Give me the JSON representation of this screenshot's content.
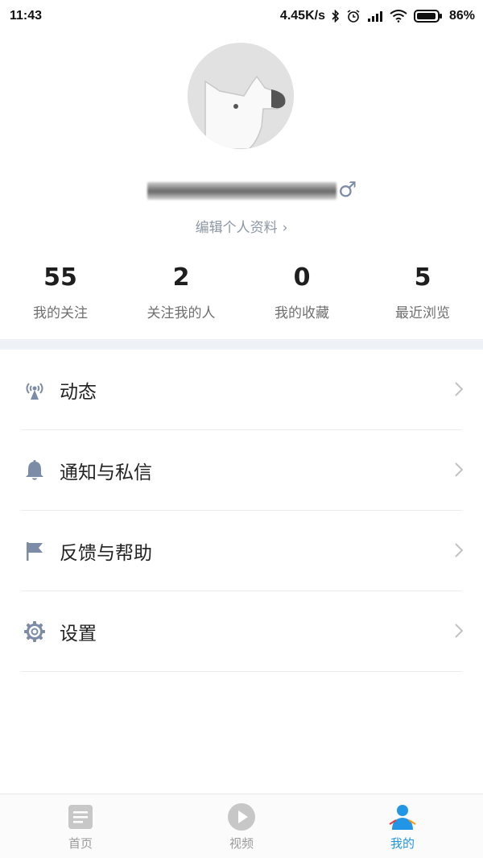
{
  "status_bar": {
    "time": "11:43",
    "network_speed": "4.45K/s",
    "battery_percent": "86%",
    "icons": [
      "bluetooth-icon",
      "alarm-icon",
      "signal-icon",
      "wifi-icon",
      "battery-icon"
    ]
  },
  "profile": {
    "avatar_icon": "default-dog-avatar",
    "gender_symbol": "♂",
    "edit_profile_label": "编辑个人资料",
    "edit_profile_chevron": "›"
  },
  "stats": [
    {
      "value": "55",
      "label": "我的关注"
    },
    {
      "value": "2",
      "label": "关注我的人"
    },
    {
      "value": "0",
      "label": "我的收藏"
    },
    {
      "value": "5",
      "label": "最近浏览"
    }
  ],
  "menu": [
    {
      "label": "动态",
      "icon": "broadcast-icon"
    },
    {
      "label": "通知与私信",
      "icon": "bell-icon"
    },
    {
      "label": "反馈与帮助",
      "icon": "flag-icon"
    },
    {
      "label": "设置",
      "icon": "gear-icon"
    }
  ],
  "tabbar": [
    {
      "label": "首页",
      "icon": "document-icon",
      "active": false
    },
    {
      "label": "视频",
      "icon": "play-icon",
      "active": false
    },
    {
      "label": "我的",
      "icon": "user-icon",
      "active": true
    }
  ],
  "colors": {
    "accent": "#2196e6",
    "icon_gray": "#7c8ba6",
    "divider": "#eef1f5"
  }
}
